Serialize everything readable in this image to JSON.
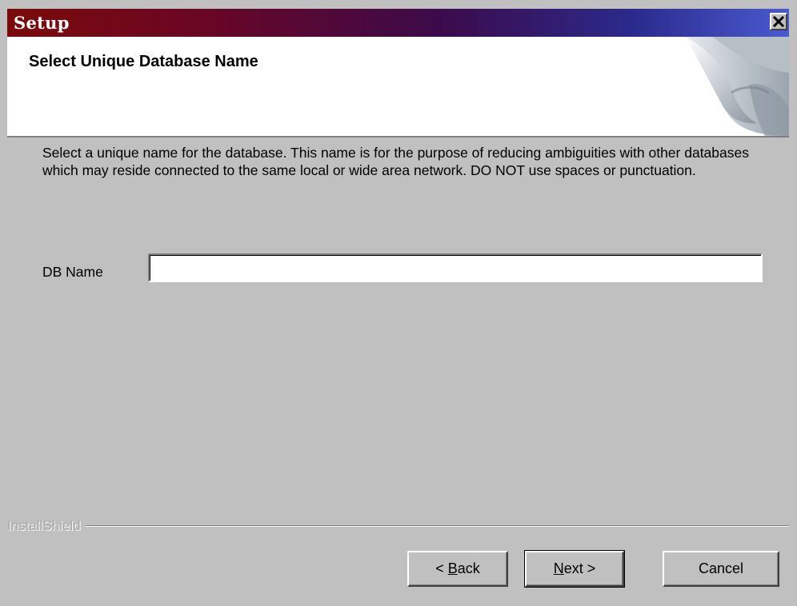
{
  "window": {
    "title": "Setup",
    "close_glyph": "✕"
  },
  "header": {
    "title": "Select Unique Database Name"
  },
  "main": {
    "description": "Select a unique name for the database.  This name is for the purpose of reducing ambiguities with other databases which may reside connected to the same local or wide area network.  DO NOT use spaces or punctuation.",
    "db_name_label": "DB Name",
    "db_name_value": ""
  },
  "footer": {
    "brand": "InstallShield",
    "back": {
      "prefix": "< ",
      "mnemonic": "B",
      "rest": "ack"
    },
    "next": {
      "prefix": "",
      "mnemonic": "N",
      "rest": "ext >"
    },
    "cancel_label": "Cancel"
  },
  "colors": {
    "title_gradient_start": "#7b0a0a",
    "title_gradient_end": "#4a5ad0",
    "dialog_face": "#c0c0c0"
  }
}
